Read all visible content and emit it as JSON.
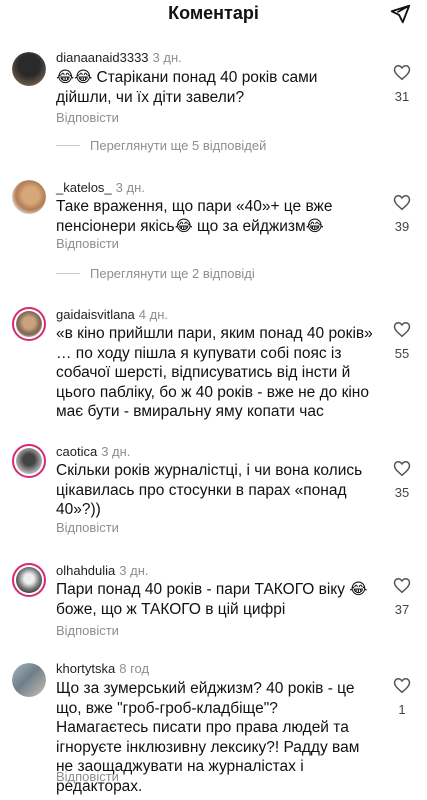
{
  "header": {
    "title": "Коментарі",
    "share_icon": "send-icon"
  },
  "comments": [
    {
      "username": "dianaanaid3333",
      "time": "3 дн.",
      "text": "😂😂 Старікани понад 40 років сами дійшли, чи їх діти завели?",
      "likes": "31",
      "reply": "Відповісти",
      "more": "Переглянути ще 5 відповідей"
    },
    {
      "username": "_katelos_",
      "time": "3 дн.",
      "text": "Таке враження, що пари «40»+ це вже пенсіонери якісь😂 що за ейджизм😂",
      "likes": "39",
      "reply": "Відповісти",
      "more": "Переглянути ще 2 відповіді"
    },
    {
      "username": "gaidaisvitlana",
      "time": "4 дн.",
      "text": "«в кіно прийшли пари, яким понад 40 років» … по ходу пішла я купувати собі пояс із собачої шерсті, відписуватись від інсти й цього пабліку, бо ж 40 років - вже  не до кіно має бути - вмиральну яму копати час",
      "likes": "55",
      "reply": ""
    },
    {
      "username": "caotica",
      "time": "3 дн.",
      "text": "Скільки років журналістці, і чи вона колись цікавилась про стосунки в парах «понад 40»?))",
      "likes": "35",
      "reply": "Відповісти"
    },
    {
      "username": "olhahdulia",
      "time": "3 дн.",
      "text": "Пари понад 40 років - пари ТАКОГО віку 😂 боже, що ж ТАКОГО в цій цифрі",
      "likes": "37",
      "reply": "Відповісти"
    },
    {
      "username": "khortytska",
      "time": "8 год",
      "text": "Що за зумерський ейджизм? 40 років - це що, вже \"гроб-гроб-кладбіще\"? Намагаєтесь писати про права людей та ігноруєте інклюзивну лексику?! Радду вам не заощаджувати на журналістах і редакторах.",
      "likes": "1",
      "reply": "Відповісти"
    }
  ],
  "colors": {
    "accent_ring": "#d62976",
    "secondary_text": "#8e8e8e"
  }
}
